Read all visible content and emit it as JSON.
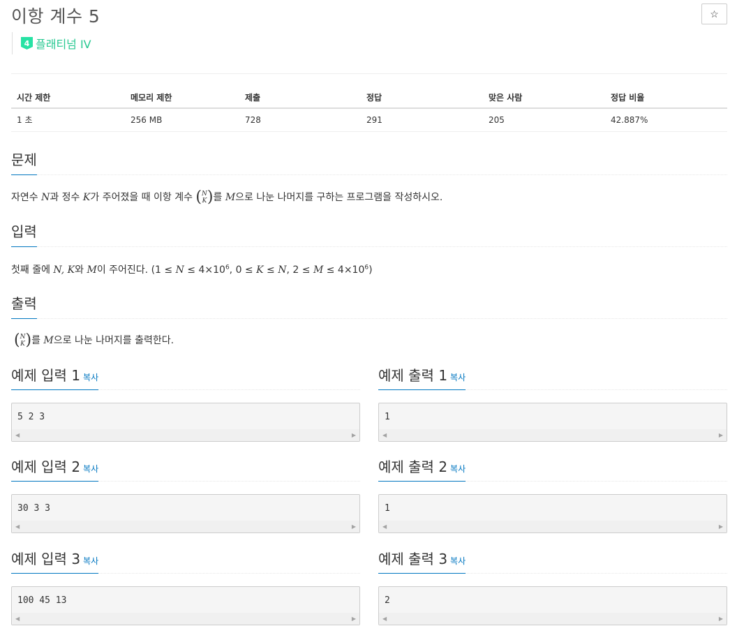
{
  "problem": {
    "title": "이항 계수 5",
    "star": "☆",
    "tier": {
      "badge": "4",
      "label": "플래티넘 IV"
    }
  },
  "info_table": {
    "headers": [
      "시간 제한",
      "메모리 제한",
      "제출",
      "정답",
      "맞은 사람",
      "정답 비율"
    ],
    "values": [
      "1 초",
      "256 MB",
      "728",
      "291",
      "205",
      "42.887%"
    ]
  },
  "sections": {
    "problem": {
      "heading": "문제",
      "t1": "자연수 ",
      "N": "N",
      "t2": "과 정수 ",
      "K": "K",
      "t3": "가 주어졌을 때 이항 계수 ",
      "binom_top": "N",
      "binom_bottom": "K",
      "t4": "를 ",
      "M": "M",
      "t5": "으로 나눈 나머지를 구하는 프로그램을 작성하시오."
    },
    "input": {
      "heading": "입력",
      "t1": "첫째 줄에 ",
      "vars": "N, K",
      "t2": "와 ",
      "M": "M",
      "t3": "이 주어진다. (",
      "c1": "1 ≤ ",
      "c1v": "N",
      "c1b": " ≤ 4×10",
      "c2": ", 0 ≤ ",
      "c2v": "K",
      "c2b": " ≤ ",
      "c2c": "N",
      "c2d": ", 2 ≤ ",
      "c2e": "M",
      "c2f": " ≤ 4×10",
      "exp": "6",
      "close": ")"
    },
    "output": {
      "heading": "출력",
      "binom_top": "N",
      "binom_bottom": "K",
      "t1": "를 ",
      "M": "M",
      "t2": "으로 나눈 나머지를 출력한다."
    }
  },
  "examples": {
    "copy_label": "복사",
    "inputs": [
      {
        "label": "예제 입력 1",
        "value": "5 2 3"
      },
      {
        "label": "예제 입력 2",
        "value": "30 3 3"
      },
      {
        "label": "예제 입력 3",
        "value": "100 45 13"
      }
    ],
    "outputs": [
      {
        "label": "예제 출력 1",
        "value": "1"
      },
      {
        "label": "예제 출력 2",
        "value": "1"
      },
      {
        "label": "예제 출력 3",
        "value": "2"
      }
    ],
    "scroll_left": "◀",
    "scroll_right": "▶"
  }
}
